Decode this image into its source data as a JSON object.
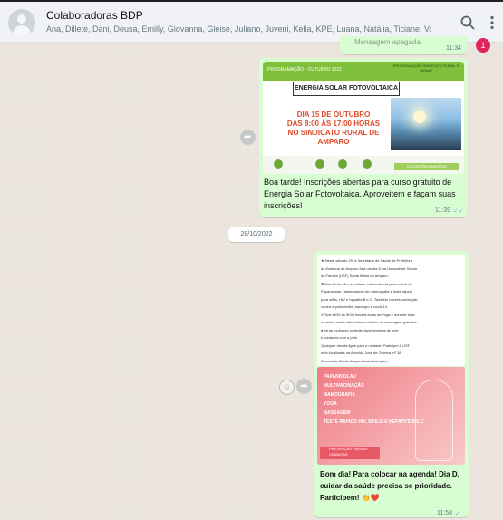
{
  "header": {
    "group_name": "Colaboradoras BDP",
    "members": "Ana, Dillete, Dani, Deusa, Emilly, Giovanna, Gleise, Juliano, Juveni, Kelia, KPE, Luana, Natália, Ticiane, Vera, Você",
    "icons": [
      "search-icon",
      "menu-dots-icon"
    ]
  },
  "notification_count": "1",
  "top_partial": {
    "label": "Mensagem apagada",
    "time": "11:34"
  },
  "message1": {
    "forward_label": "",
    "image": {
      "band_left": "PROGRAMAÇÃO - OUTUBRO 2022",
      "band_right": "PROGRAMAÇÃO SINDICATO RURAL E SENAR",
      "title": "ENERGIA SOLAR FOTOVOLTAICA",
      "date_line1": "DIA 15 DE OUTUBRO",
      "date_line2": "DAS 8:00 ÀS 17:00 HORAS",
      "date_line3": "NO SINDICATO RURAL DE",
      "date_line4": "AMPARO",
      "badge": "INSCRIÇÕES ABERTAS"
    },
    "caption": "Boa tarde! Inscrições abertas para curso gratuito de Energia Solar Fotovoltaica. Aproveitem e façam suas inscrições!",
    "time": "11:39",
    "tick": "✓✓"
  },
  "date_separator": "28/10/2022",
  "message2": {
    "text_image_lines": [
      "★ Neste sábado 29, a Secretaria de Saúde da Prefeitura",
      "da Estância de Amparo fará um dia D na Unidade de Saúde",
      "da Família (USF) Santa Maria do Amparo.",
      "⏲ Das 8h às 11h, a unidade estará aberta para coleta de",
      "Papanicolau, rastreamento de mamografia e teste rápido",
      "para sífilis, HIV e hepatite B e C. Também haverá vacinação",
      "contra a poliomielite, sarampo e covid-19.",
      "✔ Das 8h30 às 9h30 haverá aulas de Yoga e durante toda",
      "a manhã serão oferecidos cuidados de massagem gratuitos.",
      "● Já as mulheres poderão fazer limpeza de pele",
      "e cuidados com a pele.",
      "Qualquer dúvida ligue para a unidade. Participe! A USF",
      "está localizada na Avenida José de Oliveira, nº 38.",
      "Secretaria Saúde Amparo #saudeamparo"
    ],
    "poster_items": [
      "PAPANICOLAU",
      "MULTIVACINAÇÃO",
      "MAMOGRAFIA",
      "YOGA",
      "MASSAGEM",
      "TESTE RÁPIDO HIV, SÍFILIS E HEPATITE B E C"
    ],
    "poster_tag": "PREVENÇÃO PARA AS CRIANÇAS",
    "caption": "Bom dia! Para colocar na agenda! Dia D, cuidar da saúde precisa se prioridade. Participem! 👏❤️",
    "time": "11:58",
    "tick": "✓"
  }
}
